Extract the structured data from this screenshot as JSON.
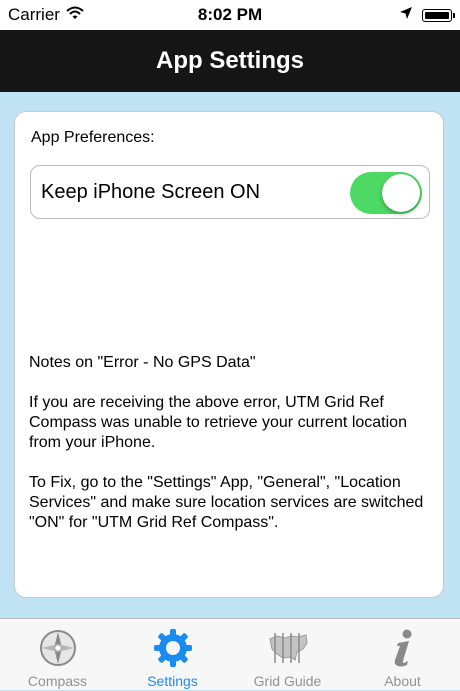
{
  "status_bar": {
    "carrier": "Carrier",
    "time": "8:02 PM",
    "wifi_icon": "wifi-icon",
    "location_icon": "location-arrow-icon",
    "battery_icon": "battery-icon"
  },
  "nav": {
    "title": "App Settings"
  },
  "preferences": {
    "section_label": "App Preferences:",
    "keep_screen_on": {
      "label": "Keep iPhone Screen ON",
      "value": true,
      "on_color": "#4cd964"
    }
  },
  "notes": {
    "heading": "Notes on \"Error - No GPS Data\"",
    "paragraph1": "If you are receiving the above error, UTM Grid Ref Compass was unable to retrieve your current location from your iPhone.",
    "paragraph2": "To Fix, go to the \"Settings\" App, \"General\", \"Location Services\" and make sure location services are switched \"ON\" for \"UTM Grid Ref Compass\"."
  },
  "tab_bar": {
    "active_color": "#1a8cf0",
    "inactive_color": "#929292",
    "tabs": [
      {
        "label": "Compass",
        "icon": "compass-icon",
        "active": false
      },
      {
        "label": "Settings",
        "icon": "gear-icon",
        "active": true
      },
      {
        "label": "Grid Guide",
        "icon": "map-grid-icon",
        "active": false
      },
      {
        "label": "About",
        "icon": "info-icon",
        "active": false
      }
    ]
  }
}
